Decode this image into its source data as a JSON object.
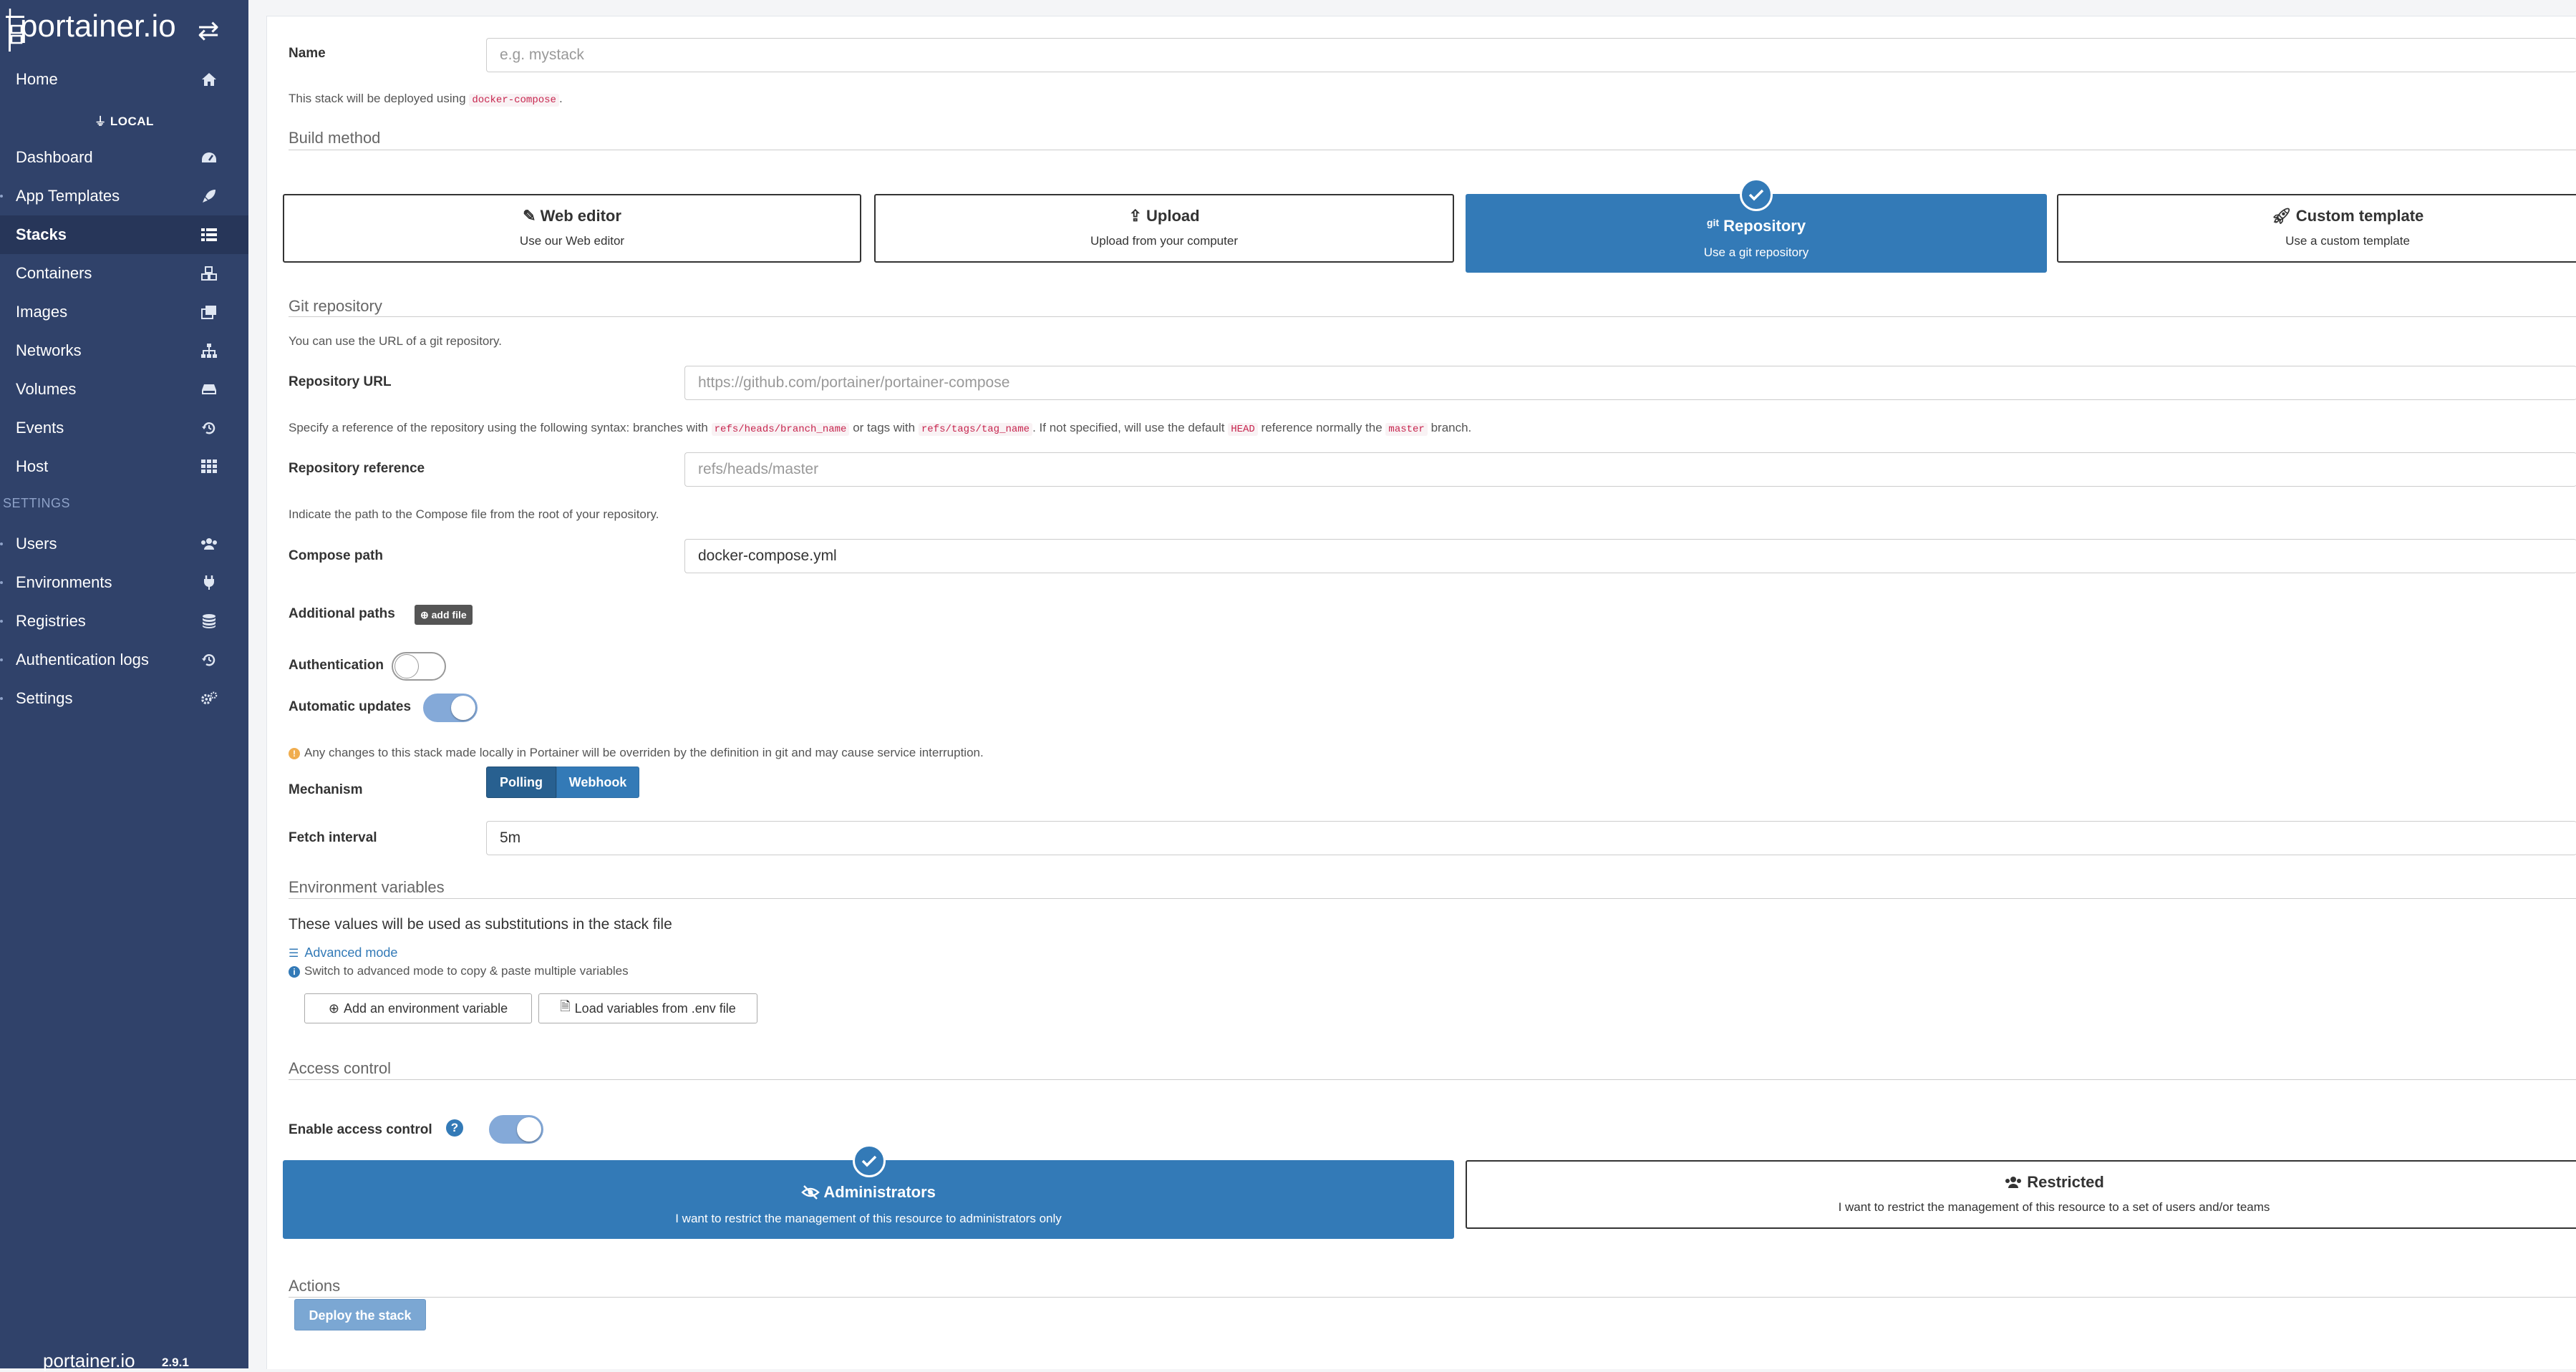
{
  "sidebar": {
    "logo": "portainer.io",
    "env_label": "LOCAL",
    "items": [
      {
        "label": "Home",
        "icon": "home-icon"
      },
      {
        "label": "Dashboard",
        "icon": "dashboard-icon"
      },
      {
        "label": "App Templates",
        "icon": "rocket-icon"
      },
      {
        "label": "Stacks",
        "icon": "list-icon"
      },
      {
        "label": "Containers",
        "icon": "cubes-icon"
      },
      {
        "label": "Images",
        "icon": "clone-icon"
      },
      {
        "label": "Networks",
        "icon": "sitemap-icon"
      },
      {
        "label": "Volumes",
        "icon": "hdd-icon"
      },
      {
        "label": "Events",
        "icon": "history-icon"
      },
      {
        "label": "Host",
        "icon": "th-icon"
      }
    ],
    "settings_header": "SETTINGS",
    "settings_items": [
      {
        "label": "Users",
        "icon": "users-icon"
      },
      {
        "label": "Environments",
        "icon": "plug-icon"
      },
      {
        "label": "Registries",
        "icon": "database-icon"
      },
      {
        "label": "Authentication logs",
        "icon": "history-icon"
      },
      {
        "label": "Settings",
        "icon": "cogs-icon"
      }
    ],
    "footer_logo": "portainer.io",
    "footer_version": "2.9.1"
  },
  "form": {
    "name_label": "Name",
    "name_placeholder": "e.g. mystack",
    "deploy_note_prefix": "This stack will be deployed using",
    "deploy_note_code": "docker-compose",
    "deploy_note_suffix": ".",
    "build_method_title": "Build method",
    "build_methods": [
      {
        "title": "Web editor",
        "subtitle": "Use our Web editor",
        "icon": "edit-icon"
      },
      {
        "title": "Upload",
        "subtitle": "Upload from your computer",
        "icon": "upload-icon"
      },
      {
        "title": "Repository",
        "subtitle": "Use a git repository",
        "icon": "git-icon",
        "icon_text": "git"
      },
      {
        "title": "Custom template",
        "subtitle": "Use a custom template",
        "icon": "rocket-icon"
      }
    ],
    "git_title": "Git repository",
    "git_note": "You can use the URL of a git repository.",
    "repo_url_label": "Repository URL",
    "repo_url_placeholder": "https://github.com/portainer/portainer-compose",
    "ref_note": {
      "p1": "Specify a reference of the repository using the following syntax: branches with",
      "c1": "refs/heads/branch_name",
      "p2": "or tags with",
      "c2": "refs/tags/tag_name",
      "p3": ". If not specified, will use the default",
      "c3": "HEAD",
      "p4": "reference normally the",
      "c4": "master",
      "p5": "branch."
    },
    "repo_ref_label": "Repository reference",
    "repo_ref_placeholder": "refs/heads/master",
    "compose_note": "Indicate the path to the Compose file from the root of your repository.",
    "compose_path_label": "Compose path",
    "compose_path_value": "docker-compose.yml",
    "additional_paths_label": "Additional paths",
    "add_file_label": "add file",
    "authentication_label": "Authentication",
    "auto_updates_label": "Automatic updates",
    "warning_text": "Any changes to this stack made locally in Portainer will be overriden by the definition in git and may cause service interruption.",
    "mechanism_label": "Mechanism",
    "mechanism_options": [
      "Polling",
      "Webhook"
    ],
    "mechanism_selected": "Polling",
    "fetch_interval_label": "Fetch interval",
    "fetch_interval_value": "5m",
    "env_vars_title": "Environment variables",
    "env_vars_desc": "These values will be used as substitutions in the stack file",
    "advanced_mode_label": "Advanced mode",
    "advanced_mode_hint": "Switch to advanced mode to copy & paste multiple variables",
    "add_env_var_label": "Add an environment variable",
    "load_env_file_label": "Load variables from .env file",
    "access_control_title": "Access control",
    "enable_access_label": "Enable access control",
    "access_options": [
      {
        "title": "Administrators",
        "subtitle": "I want to restrict the management of this resource to administrators only",
        "icon": "eye-slash-icon"
      },
      {
        "title": "Restricted",
        "subtitle": "I want to restrict the management of this resource to a set of users and/or teams",
        "icon": "users-icon"
      }
    ],
    "actions_title": "Actions",
    "deploy_button_label": "Deploy the stack"
  },
  "colors": {
    "sidebar_bg": "#30426a",
    "primary": "#337ab7",
    "warning": "#f0ad4e"
  }
}
